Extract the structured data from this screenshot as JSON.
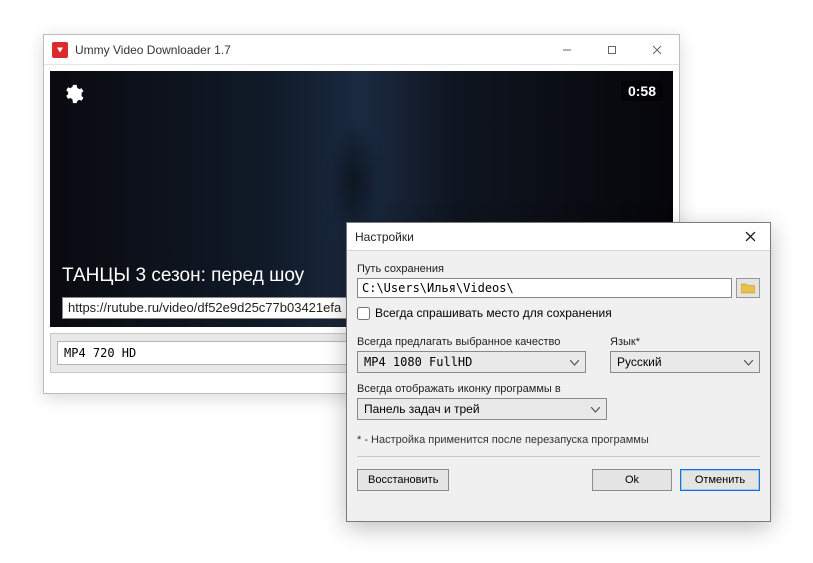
{
  "window": {
    "title": "Ummy Video Downloader 1.7"
  },
  "video": {
    "duration": "0:58",
    "title": "ТАНЦЫ 3 сезон: перед шоу",
    "url": "https://rutube.ru/video/df52e9d25c77b03421efa"
  },
  "quality_select": "MP4  720  HD",
  "dialog": {
    "title": "Настройки",
    "save_path_label": "Путь сохранения",
    "save_path_value": "C:\\Users\\Илья\\Videos\\",
    "ask_label": "Всегда спрашивать место для сохранения",
    "quality_label": "Всегда предлагать выбранное качество",
    "quality_value": "MP4  1080  FullHD",
    "lang_label": "Язык*",
    "lang_value": "Русский",
    "tray_label": "Всегда отображать иконку программы в",
    "tray_value": "Панель задач и трей",
    "note": "* - Настройка применится после перезапуска программы",
    "restore_btn": "Восстановить",
    "ok_btn": "Ok",
    "cancel_btn": "Отменить"
  }
}
